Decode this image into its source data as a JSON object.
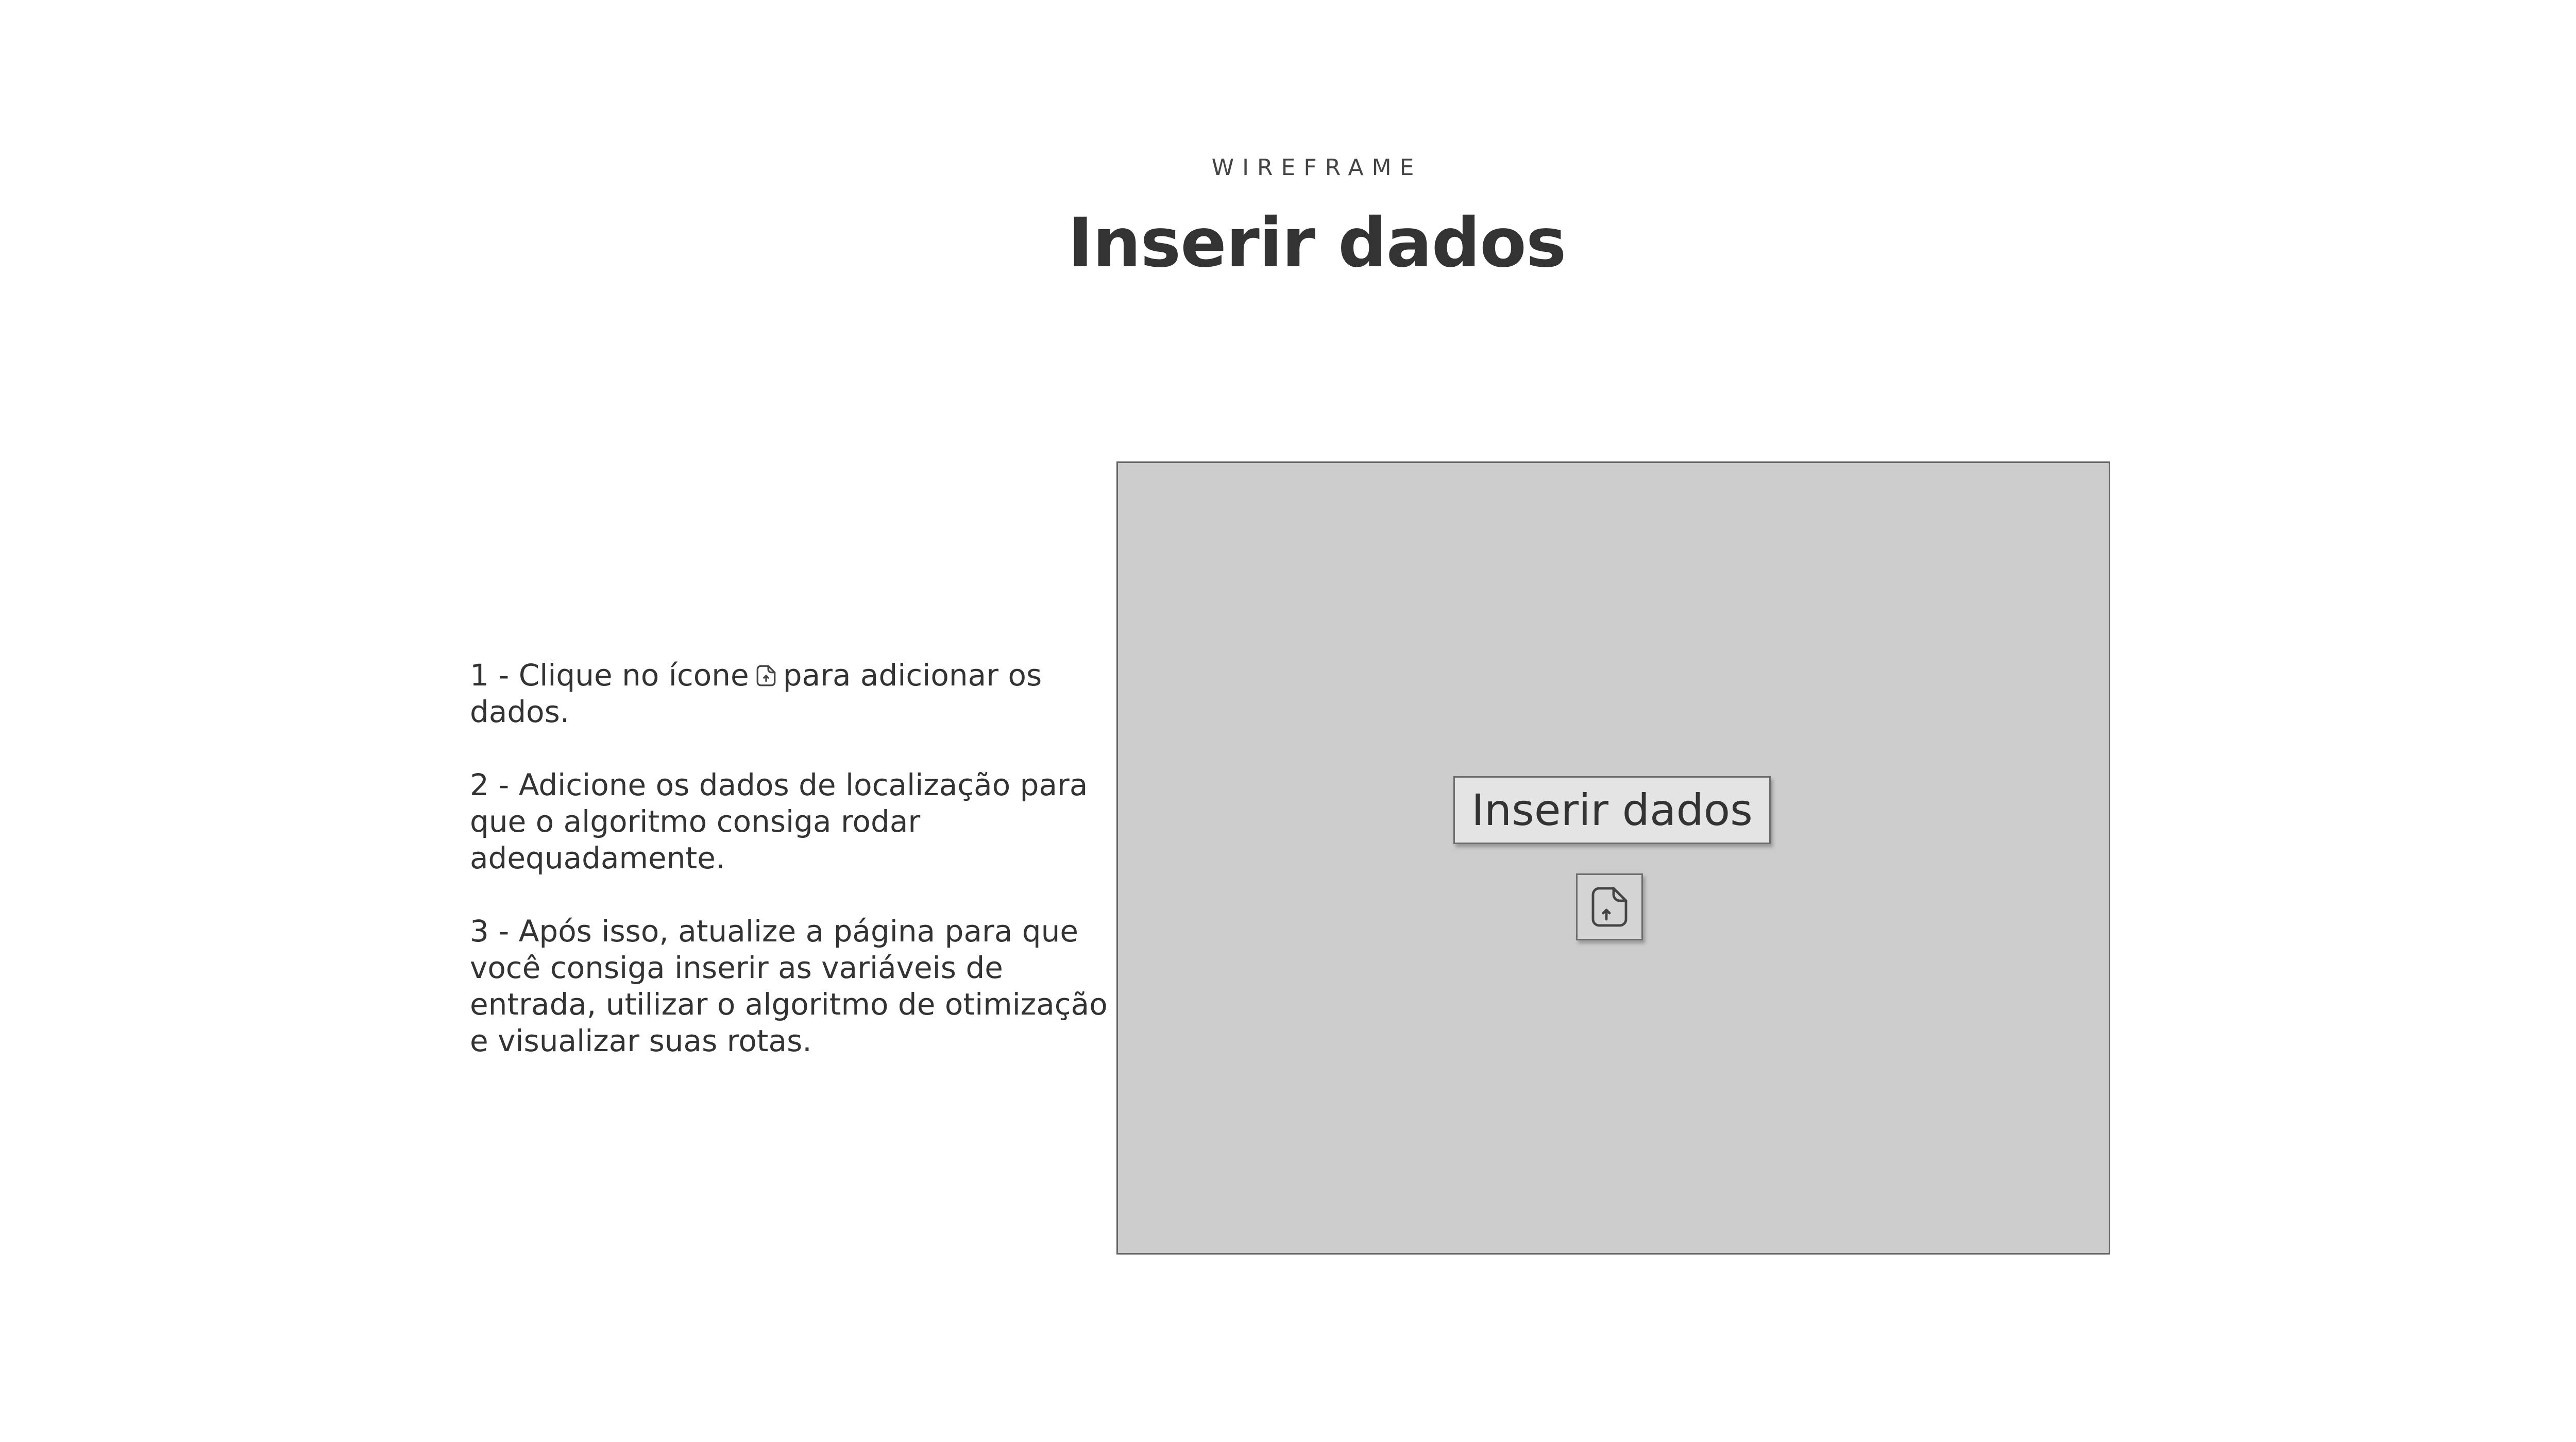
{
  "header": {
    "eyebrow": "WIREFRAME",
    "title": "Inserir dados"
  },
  "instructions": {
    "step1_before_icon": "1 - Clique no ícone",
    "step1_icon": "file-upload-icon",
    "step1_after_icon": "para adicionar os dados.",
    "step2": "2 - Adicione os dados de localização para que o algoritmo consiga rodar adequadamente.",
    "step3": "3 - Após isso, atualize a página para que você consiga inserir as variáveis de entrada, utilizar o algoritmo de otimização e visualizar suas rotas."
  },
  "panel": {
    "insert_button_label": "Inserir dados",
    "upload_icon": "file-upload-icon"
  },
  "colors": {
    "panel_background": "#cccccc",
    "text": "#333333",
    "border": "#666666"
  }
}
